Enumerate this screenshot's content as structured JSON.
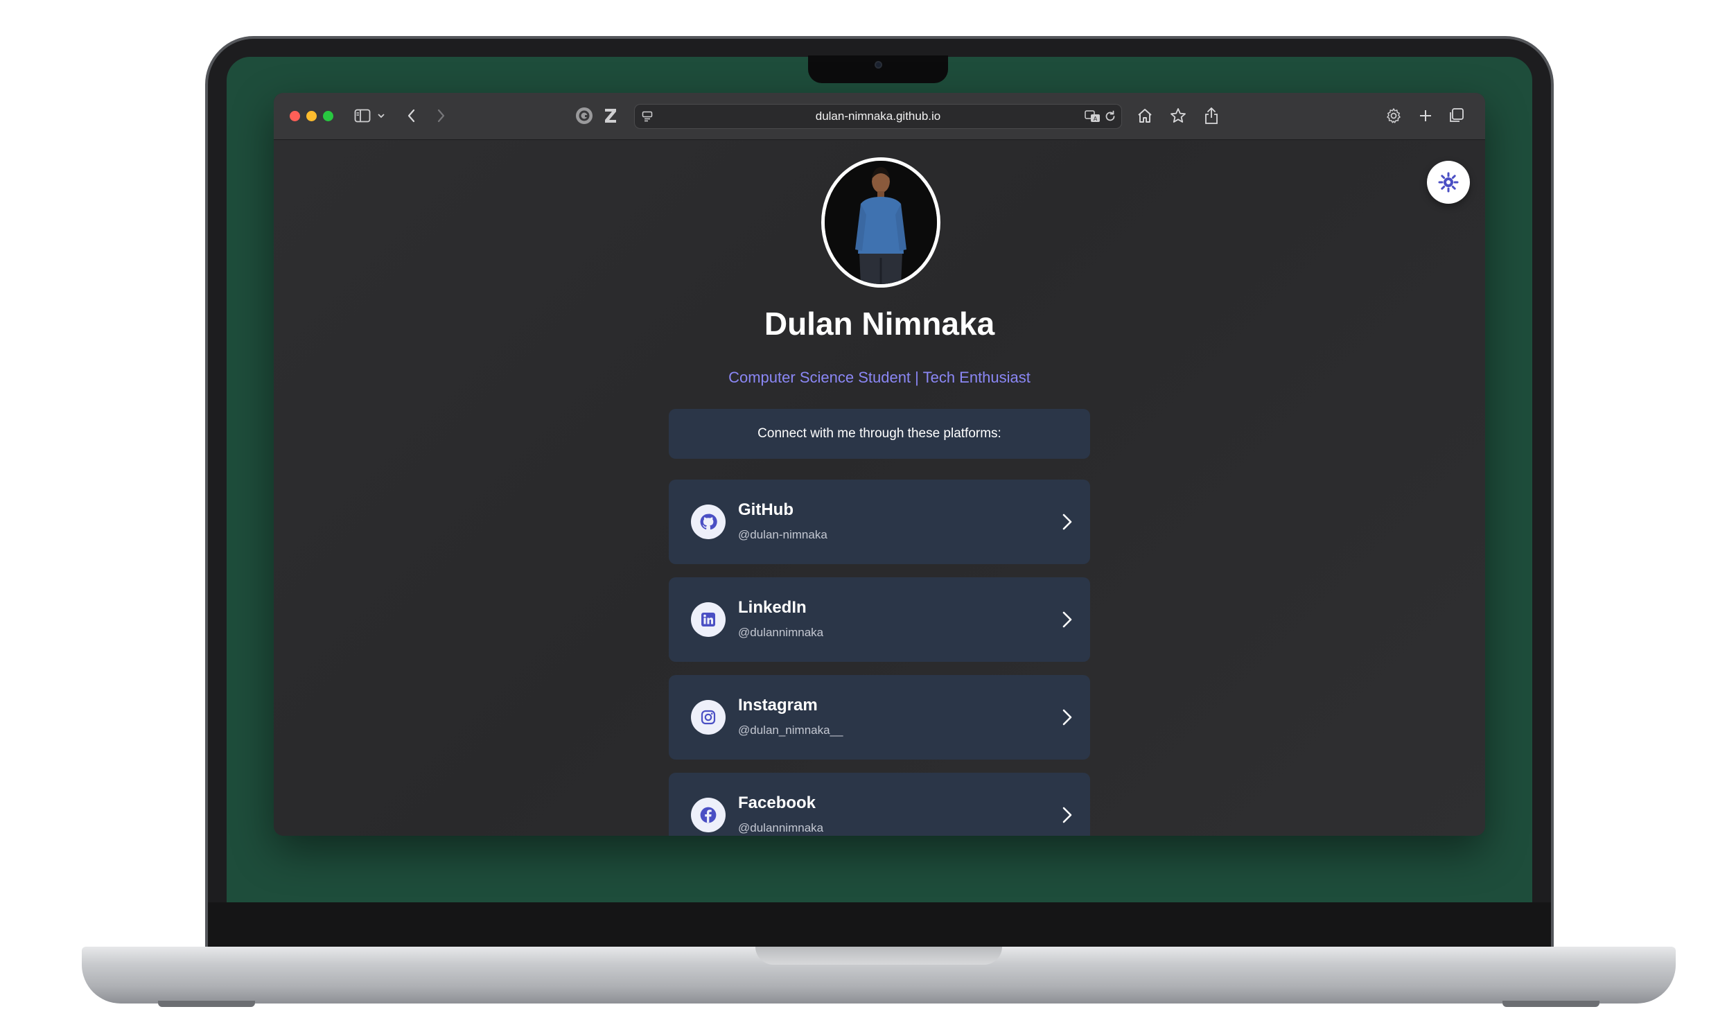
{
  "browser": {
    "url": "dulan-nimnaka.github.io"
  },
  "profile": {
    "name": "Dulan Nimnaka",
    "subtitle": "Computer Science Student | Tech Enthusiast",
    "connect_text": "Connect with me through these platforms:",
    "avatar_icon": "person-photo"
  },
  "links": [
    {
      "platform": "GitHub",
      "handle": "@dulan-nimnaka",
      "icon": "github-icon"
    },
    {
      "platform": "LinkedIn",
      "handle": "@dulannimnaka",
      "icon": "linkedin-icon"
    },
    {
      "platform": "Instagram",
      "handle": "@dulan_nimnaka__",
      "icon": "instagram-icon"
    },
    {
      "platform": "Facebook",
      "handle": "@dulannimnaka",
      "icon": "facebook-icon"
    }
  ],
  "colors": {
    "accent": "#8b87f5",
    "icon_accent": "#4a4fc4",
    "card_bg": "#2b3648",
    "page_bg": "#2c2c2e",
    "desktop_bg": "#1e4d3b"
  }
}
